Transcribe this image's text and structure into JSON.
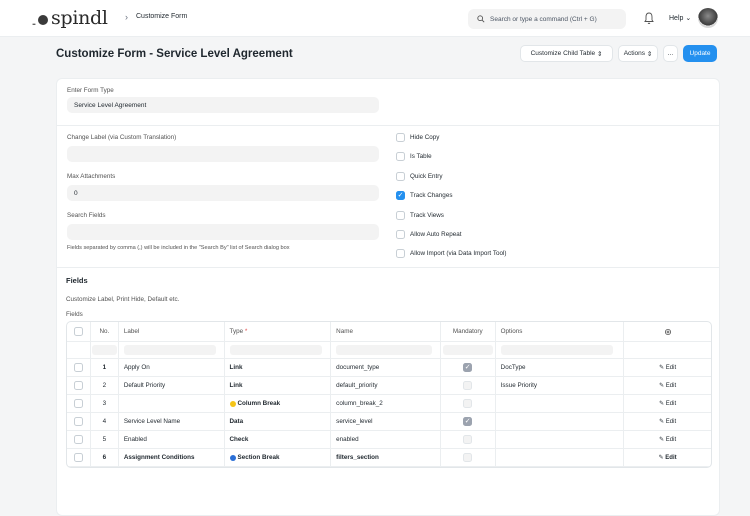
{
  "app": {
    "logo_mark": "..",
    "logo_text": "spindl",
    "breadcrumb": "Customize Form"
  },
  "navbar": {
    "search_placeholder": "Search or type a command (Ctrl + G)",
    "help_label": "Help"
  },
  "page": {
    "title": "Customize Form - Service Level Agreement",
    "buttons": {
      "child_table": "Customize Child Table",
      "actions": "Actions",
      "more": "...",
      "update": "Update"
    }
  },
  "form_type": {
    "label": "Enter Form Type",
    "value": "Service Level Agreement"
  },
  "settings": {
    "change_label": {
      "label": "Change Label (via Custom Translation)",
      "value": ""
    },
    "max_attachments": {
      "label": "Max Attachments",
      "value": "0"
    },
    "search_fields": {
      "label": "Search Fields",
      "value": "",
      "help": "Fields separated by comma (,) will be included in the \"Search By\" list of Search dialog box"
    },
    "checks": [
      {
        "label": "Hide Copy",
        "checked": false
      },
      {
        "label": "Is Table",
        "checked": false
      },
      {
        "label": "Quick Entry",
        "checked": false
      },
      {
        "label": "Track Changes",
        "checked": true
      },
      {
        "label": "Track Views",
        "checked": false
      },
      {
        "label": "Allow Auto Repeat",
        "checked": false
      },
      {
        "label": "Allow Import (via Data Import Tool)",
        "checked": false
      }
    ]
  },
  "fields_section": {
    "title": "Fields",
    "description": "Customize Label, Print Hide, Default etc.",
    "grid_label": "Fields",
    "columns": {
      "no": "No.",
      "label": "Label",
      "type": "Type",
      "type_required": "*",
      "name": "Name",
      "mandatory": "Mandatory",
      "options": "Options"
    },
    "rows": [
      {
        "no": "1",
        "label": "Apply On",
        "type": "Link",
        "name": "document_type",
        "mandatory": true,
        "options": "DocType",
        "edit": "Edit",
        "bold": false,
        "dot": ""
      },
      {
        "no": "2",
        "label": "Default Priority",
        "type": "Link",
        "name": "default_priority",
        "mandatory": false,
        "options": "Issue Priority",
        "edit": "Edit",
        "bold": false,
        "dot": ""
      },
      {
        "no": "3",
        "label": "",
        "type": "Column Break",
        "name": "column_break_2",
        "mandatory": false,
        "options": "",
        "edit": "Edit",
        "bold": false,
        "dot": "#f5c518"
      },
      {
        "no": "4",
        "label": "Service Level Name",
        "type": "Data",
        "name": "service_level",
        "mandatory": true,
        "options": "",
        "edit": "Edit",
        "bold": false,
        "dot": ""
      },
      {
        "no": "5",
        "label": "Enabled",
        "type": "Check",
        "name": "enabled",
        "mandatory": false,
        "options": "",
        "edit": "Edit",
        "bold": false,
        "dot": ""
      },
      {
        "no": "6",
        "label": "Assignment Conditions",
        "type": "Section Break",
        "name": "filters_section",
        "mandatory": false,
        "options": "",
        "edit": "Edit",
        "bold": true,
        "dot": "#2b6fd6"
      }
    ]
  },
  "colors": {
    "primary": "#2490ef",
    "text": "#1f272e",
    "page_bg": "#f4f5f6",
    "required": "#e24c4c"
  }
}
